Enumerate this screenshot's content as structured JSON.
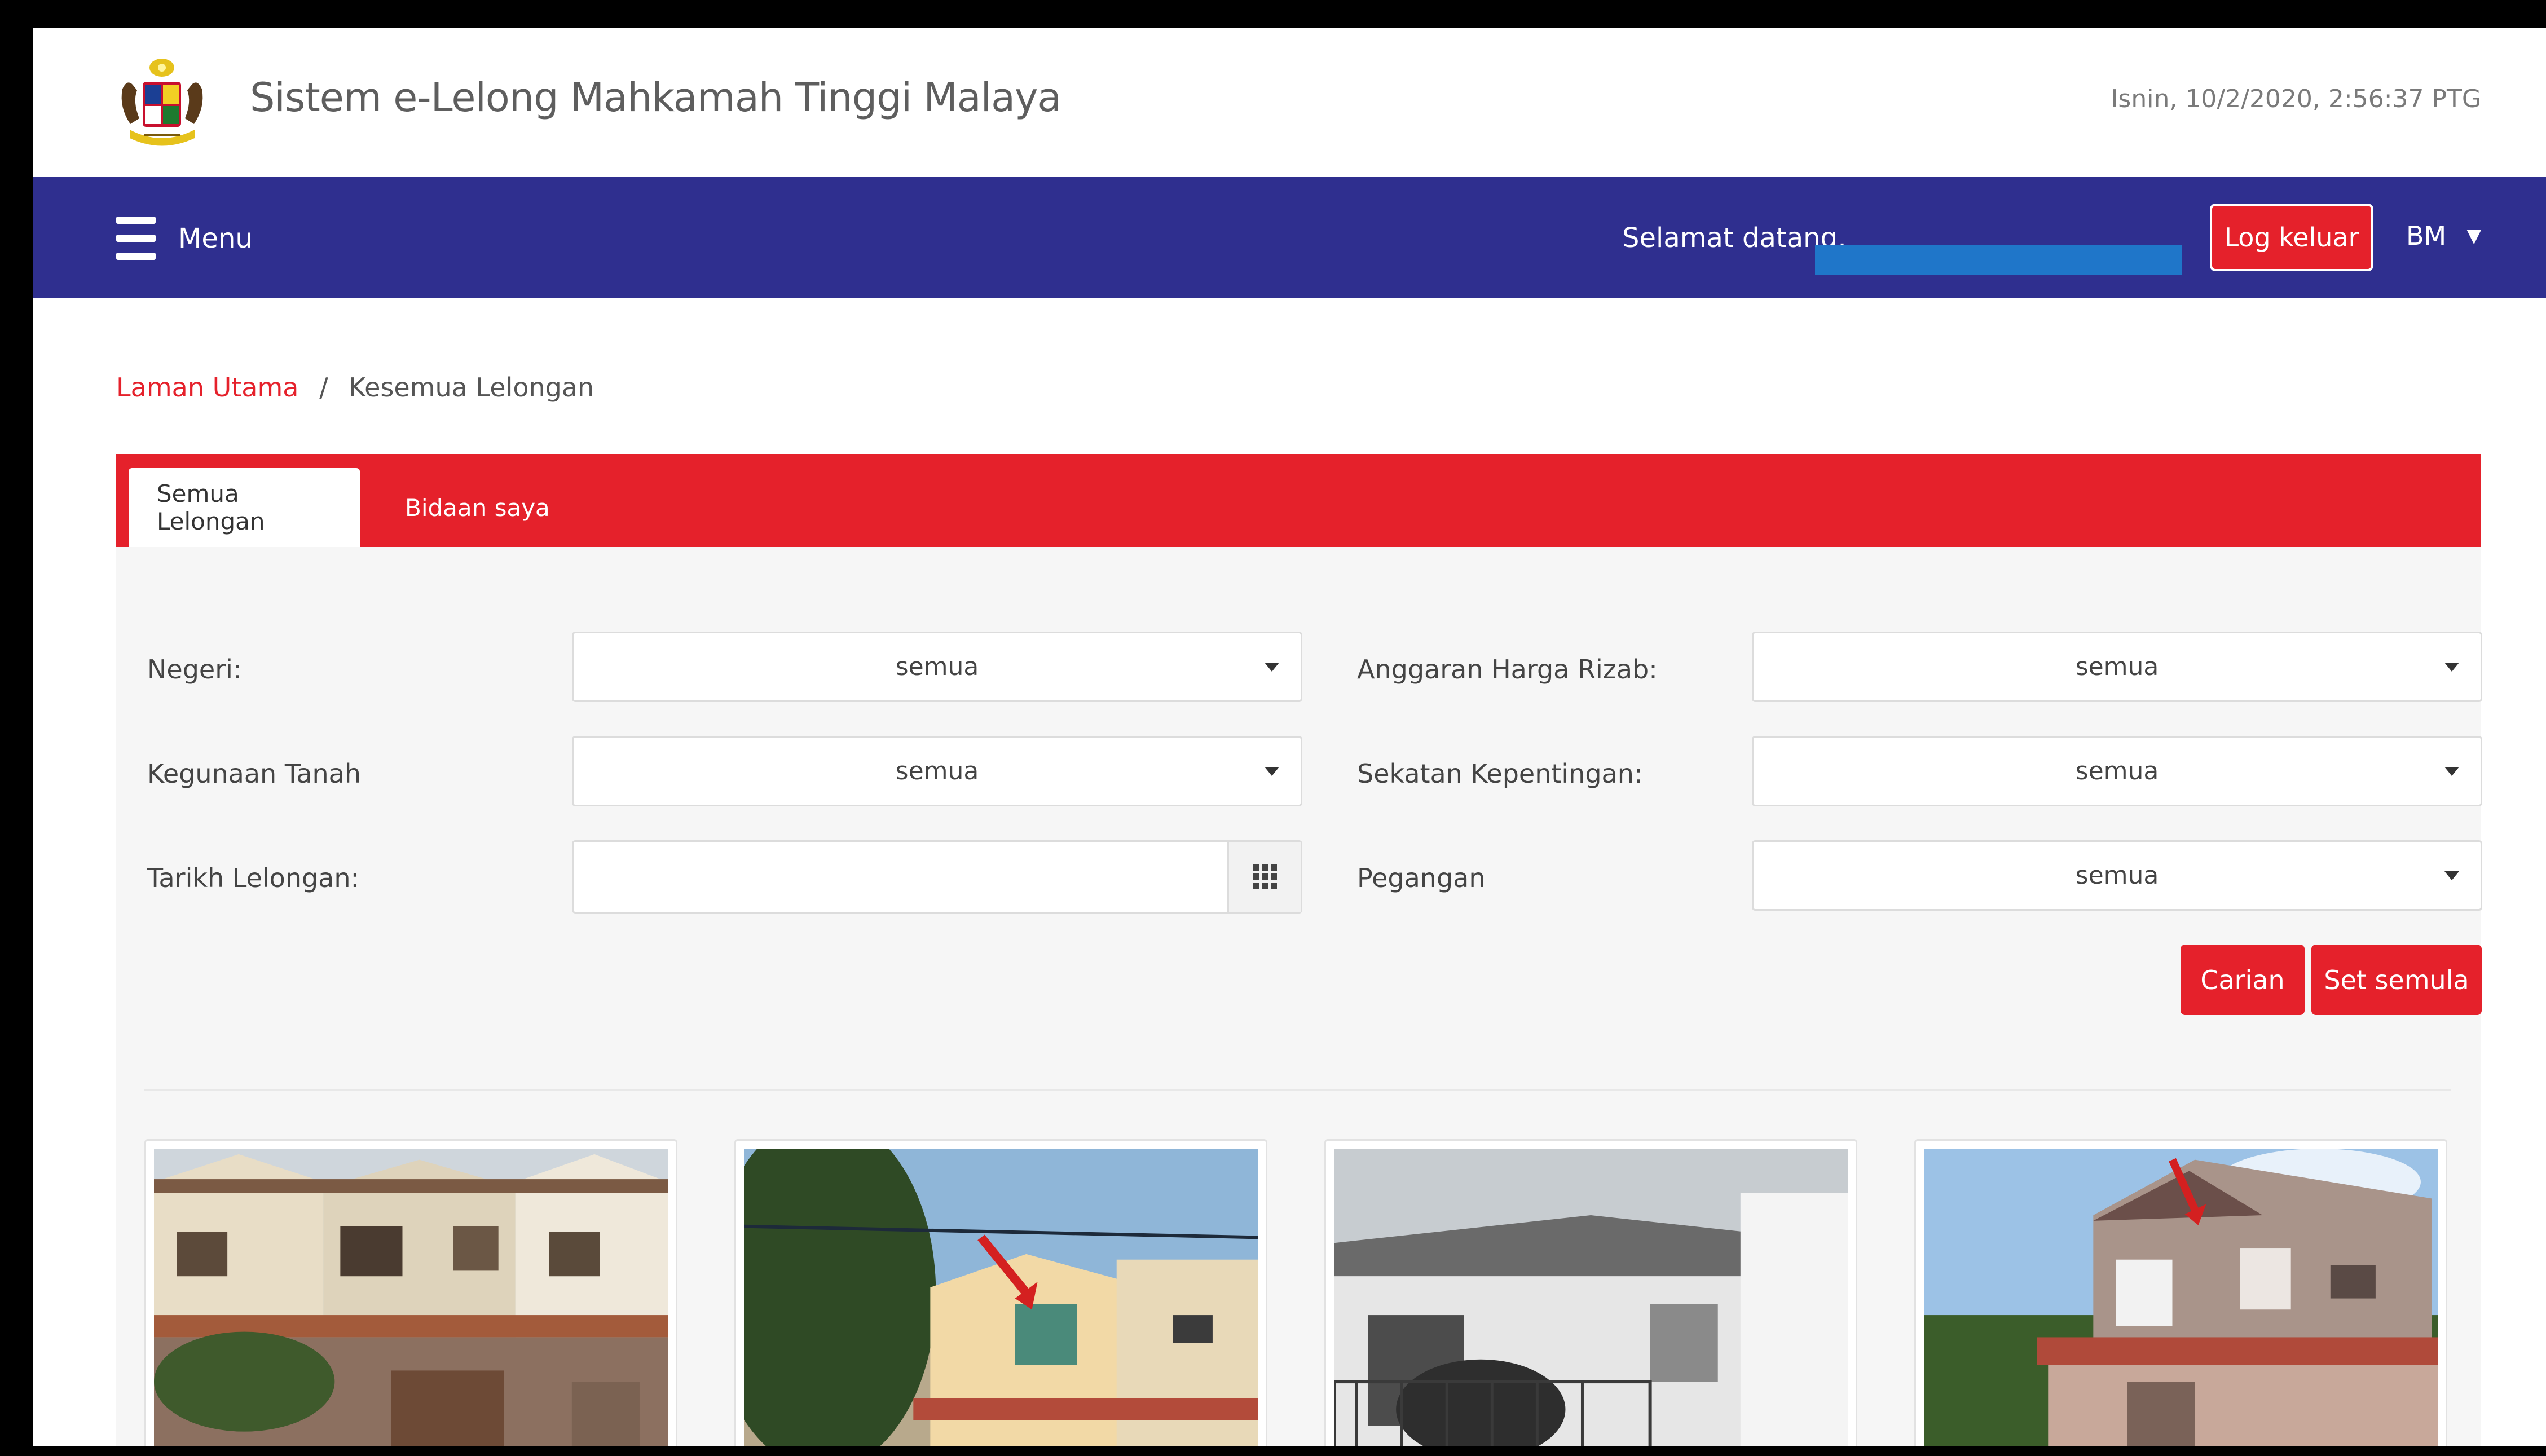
{
  "header": {
    "title": "Sistem e-Lelong Mahkamah Tinggi Malaya",
    "datetime": "Isnin, 10/2/2020, 2:56:37 PTG",
    "logo_icon": "malaysia-coat-of-arms"
  },
  "navbar": {
    "menu_label": "Menu",
    "welcome_label": "Selamat datang,",
    "logout_label": "Log keluar",
    "language": "BM"
  },
  "breadcrumb": {
    "home": "Laman Utama",
    "separator": "/",
    "current": "Kesemua Lelongan"
  },
  "tabs": [
    {
      "label": "Semua Lelongan",
      "active": true
    },
    {
      "label": "Bidaan saya",
      "active": false
    }
  ],
  "filters": {
    "negeri": {
      "label": "Negeri:",
      "value": "semua"
    },
    "kegunaan_tanah": {
      "label": "Kegunaan Tanah",
      "value": "semua"
    },
    "tarikh_lelongan": {
      "label": "Tarikh Lelongan:",
      "value": ""
    },
    "anggaran_harga_rizab": {
      "label": "Anggaran Harga Rizab:",
      "value": "semua"
    },
    "sekatan_kepentingan": {
      "label": "Sekatan Kepentingan:",
      "value": "semua"
    },
    "pegangan": {
      "label": "Pegangan",
      "value": "semua"
    }
  },
  "actions": {
    "search_label": "Carian",
    "reset_label": "Set semula"
  },
  "colors": {
    "brand_red": "#e5212b",
    "navbar_blue": "#2f2f8f"
  }
}
